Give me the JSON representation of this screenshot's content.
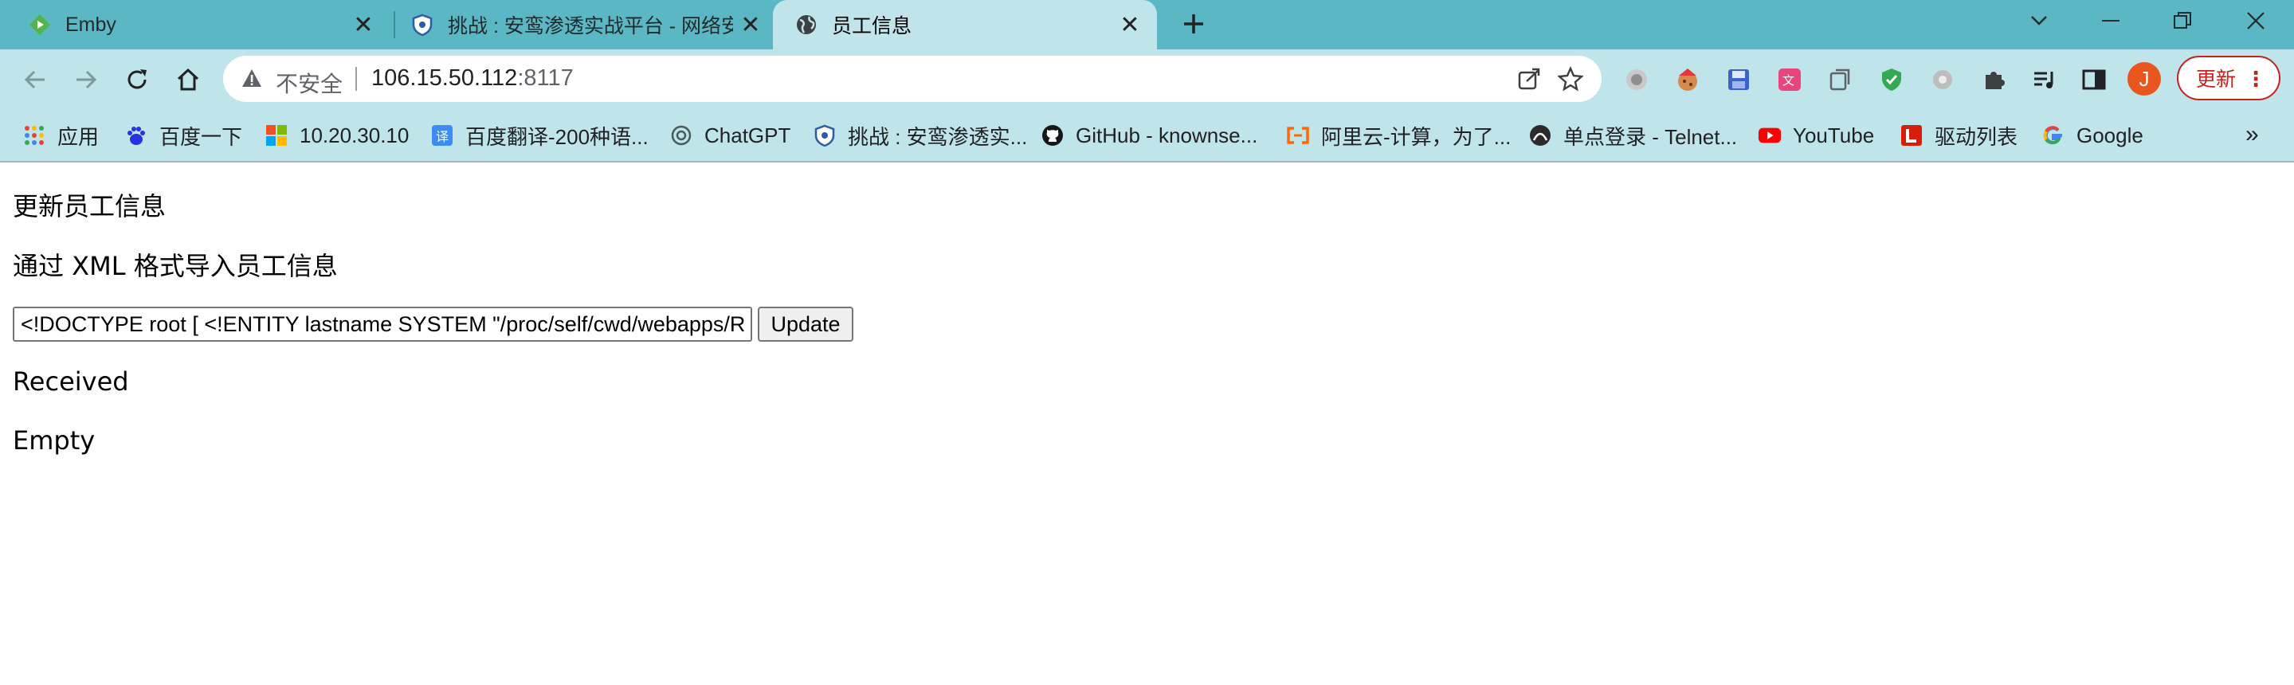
{
  "browser": {
    "tabs": [
      {
        "title": "Emby",
        "icon": "emby-icon",
        "active": false
      },
      {
        "title": "挑战 : 安鸾渗透实战平台 - 网络安",
        "icon": "shield-icon",
        "active": false
      },
      {
        "title": "员工信息",
        "icon": "globe-icon",
        "active": true
      }
    ],
    "address": {
      "security_label": "不安全",
      "host": "106.15.50.112",
      "port": ":8117"
    },
    "profile_initial": "J",
    "update_label": "更新",
    "bookmarks": [
      {
        "label": "应用",
        "icon": "apps-grid-icon"
      },
      {
        "label": "百度一下",
        "icon": "baidu-icon"
      },
      {
        "label": "10.20.30.10",
        "icon": "windows-icon"
      },
      {
        "label": "百度翻译-200种语...",
        "icon": "baidu-translate-icon"
      },
      {
        "label": "ChatGPT",
        "icon": "chatgpt-icon"
      },
      {
        "label": "挑战 : 安鸾渗透实...",
        "icon": "shield-icon"
      },
      {
        "label": "GitHub - knownse...",
        "icon": "github-icon"
      },
      {
        "label": "阿里云-计算，为了...",
        "icon": "aliyun-icon"
      },
      {
        "label": "单点登录 - Telnet...",
        "icon": "telnet-icon"
      },
      {
        "label": "YouTube",
        "icon": "youtube-icon"
      },
      {
        "label": "驱动列表",
        "icon": "driver-list-icon"
      },
      {
        "label": "Google",
        "icon": "google-icon"
      }
    ],
    "colors": {
      "frame": "#5bb7c3",
      "toolbar": "#bfe4e9",
      "update_accent": "#c5221f",
      "avatar": "#e8551f"
    }
  },
  "page": {
    "heading": "更新员工信息",
    "subheading": "通过 XML 格式导入员工信息",
    "xml_value": "<!DOCTYPE root [ <!ENTITY lastname SYSTEM \"/proc/self/cwd/webapps/ROOT/WEB-INF/web.xml\"> ]>",
    "update_button": "Update",
    "status_received": "Received",
    "status_empty": "Empty"
  }
}
